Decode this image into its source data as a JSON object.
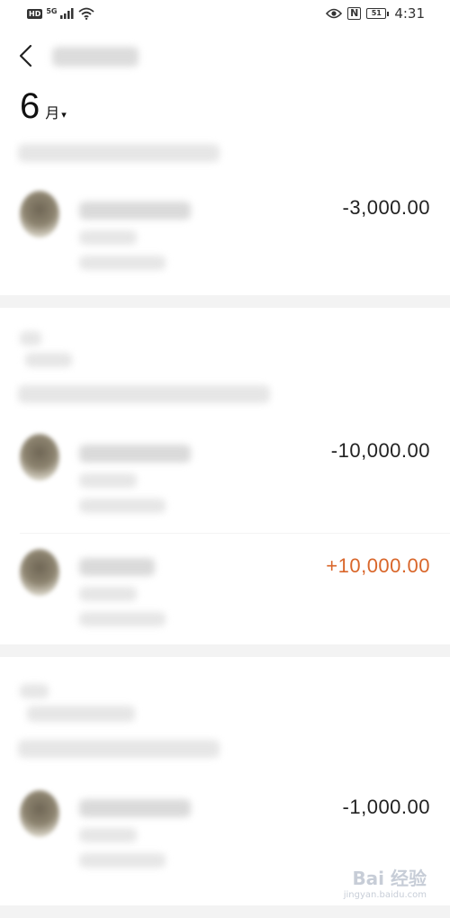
{
  "status_bar": {
    "left_badges": [
      "HD",
      "5G"
    ],
    "nfc": "N",
    "battery": "51",
    "time": "4:31"
  },
  "header": {
    "month_number": "6",
    "month_unit": "月",
    "caret": "▾"
  },
  "records": [
    {
      "amount": "-3,000.00",
      "type": "expense"
    },
    {
      "amount": "-10,000.00",
      "type": "expense"
    },
    {
      "amount": "+10,000.00",
      "type": "income"
    },
    {
      "amount": "-1,000.00",
      "type": "expense"
    }
  ],
  "icons": {
    "back": "back-arrow-icon",
    "signal": "signal-icon",
    "wifi": "wifi-icon",
    "eye": "eye-icon"
  },
  "colors": {
    "income": "#d9662a",
    "expense": "#222222",
    "divider": "#f3f3f3"
  },
  "watermark": {
    "logo": "Bai 经验",
    "url": "jingyan.baidu.com"
  }
}
